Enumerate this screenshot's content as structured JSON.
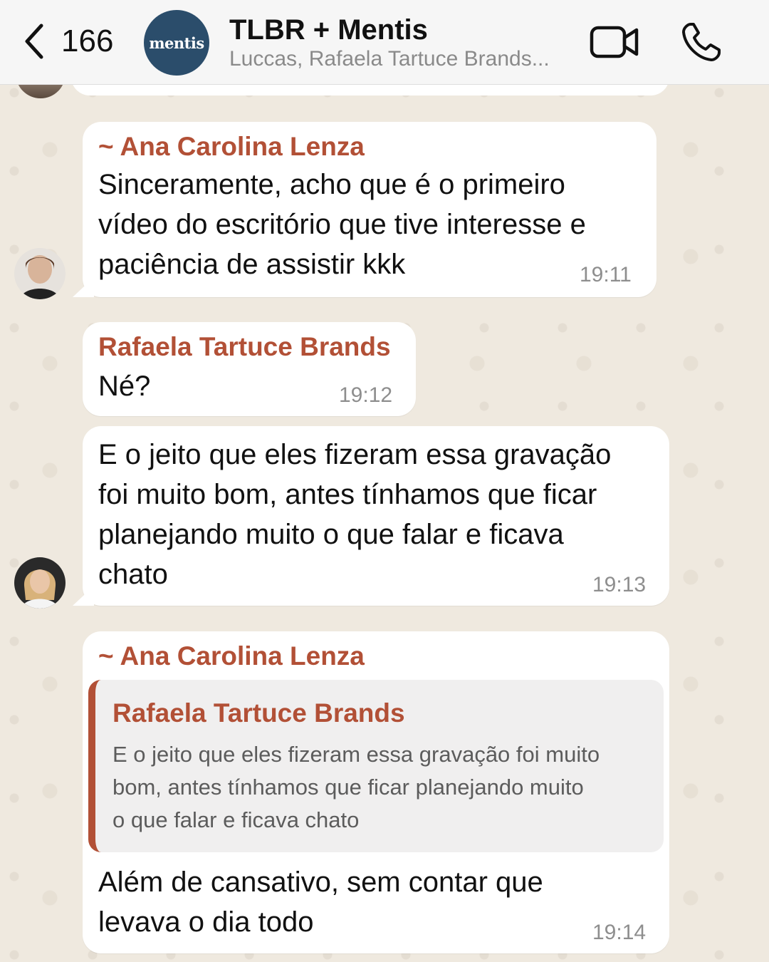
{
  "header": {
    "back_count": "166",
    "group_avatar_text": "mentis",
    "title": "TLBR + Mentis",
    "subtitle": "Luccas, Rafaela Tartuce Brands..."
  },
  "messages": [
    {
      "sender": "~ Ana Carolina Lenza",
      "text": "Sinceramente, acho que é o primeiro\nvídeo do escritório que tive interesse e\npaciência de assistir kkk",
      "time": "19:11"
    },
    {
      "sender": "Rafaela Tartuce Brands",
      "text": "Né?",
      "time": "19:12"
    },
    {
      "text": "E o jeito que eles fizeram essa gravação\nfoi muito bom, antes tínhamos que ficar\nplanejando muito o que falar e ficava\nchato",
      "time": "19:13"
    },
    {
      "sender": "~ Ana Carolina Lenza",
      "quote": {
        "sender": "Rafaela Tartuce Brands",
        "text": "E o jeito que eles fizeram essa gravação foi muito\nbom, antes tínhamos que ficar planejando muito\no que falar e ficava chato"
      },
      "text": "Além de cansativo, sem contar que\nlevava o dia todo",
      "time": "19:14"
    }
  ]
}
